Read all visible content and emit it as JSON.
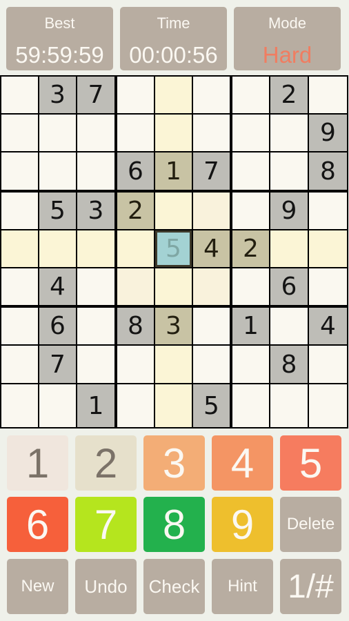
{
  "header": {
    "best": {
      "label": "Best",
      "value": "59:59:59"
    },
    "time": {
      "label": "Time",
      "value": "00:00:56"
    },
    "mode": {
      "label": "Mode",
      "value": "Hard"
    }
  },
  "board": {
    "selected": {
      "row": 4,
      "col": 4
    },
    "cells": [
      [
        null,
        "3",
        "7",
        null,
        null,
        null,
        null,
        "2",
        null
      ],
      [
        null,
        null,
        null,
        null,
        null,
        null,
        null,
        null,
        "9"
      ],
      [
        null,
        null,
        null,
        "6",
        "1",
        "7",
        null,
        null,
        "8"
      ],
      [
        null,
        "5",
        "3",
        "2",
        null,
        null,
        null,
        "9",
        null
      ],
      [
        null,
        null,
        null,
        null,
        "5",
        "4",
        "2",
        null,
        null
      ],
      [
        null,
        "4",
        null,
        null,
        null,
        null,
        null,
        "6",
        null
      ],
      [
        null,
        "6",
        null,
        "8",
        "3",
        null,
        "1",
        null,
        "4"
      ],
      [
        null,
        "7",
        null,
        null,
        null,
        null,
        null,
        "8",
        null
      ],
      [
        null,
        null,
        "1",
        null,
        null,
        "5",
        null,
        null,
        null
      ]
    ],
    "user_entered": [
      [
        4,
        4
      ]
    ]
  },
  "keypad": {
    "numbers": [
      {
        "label": "1",
        "color": "#f0e6dd",
        "text_color": "#7b7268"
      },
      {
        "label": "2",
        "color": "#e6e0cb",
        "text_color": "#7b7268"
      },
      {
        "label": "3",
        "color": "#f3ad76",
        "text_color": "#fbf8f2"
      },
      {
        "label": "4",
        "color": "#f49564",
        "text_color": "#fbf8f2"
      },
      {
        "label": "5",
        "color": "#f67c5f",
        "text_color": "#fbf8f2"
      },
      {
        "label": "6",
        "color": "#f6603b",
        "text_color": "#fbf8f2"
      },
      {
        "label": "7",
        "color": "#b5e51e",
        "text_color": "#fbf8f2"
      },
      {
        "label": "8",
        "color": "#23b14d",
        "text_color": "#fbf8f2"
      },
      {
        "label": "9",
        "color": "#eebf2d",
        "text_color": "#fbf8f2"
      }
    ],
    "delete_label": "Delete",
    "actions": [
      {
        "name": "new",
        "label": "New"
      },
      {
        "name": "undo",
        "label": "Undo"
      },
      {
        "name": "check",
        "label": "Check"
      },
      {
        "name": "hint",
        "label": "Hint"
      },
      {
        "name": "number-mode",
        "label": "1/#"
      }
    ],
    "action_color": "#b8ada1"
  }
}
